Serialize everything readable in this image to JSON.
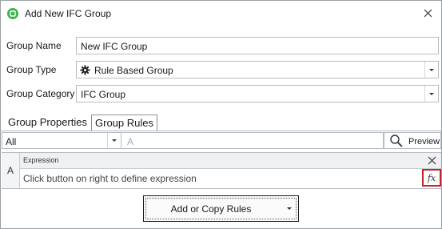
{
  "window": {
    "title": "Add New IFC Group",
    "icon": "app-logo-icon",
    "close_icon": "close-icon"
  },
  "form": {
    "group_name": {
      "label": "Group Name",
      "value": "New IFC Group"
    },
    "group_type": {
      "label": "Group Type",
      "value": "Rule Based Group",
      "icon": "gear-icon"
    },
    "group_category": {
      "label": "Group Category",
      "value": "IFC Group"
    }
  },
  "tabs": [
    {
      "label": "Group Properties",
      "active": false
    },
    {
      "label": "Group Rules",
      "active": true
    }
  ],
  "filter": {
    "select_value": "All",
    "search_placeholder": "A",
    "preview_label": "Preview",
    "preview_icon": "search-icon"
  },
  "rule": {
    "letter": "A",
    "header_label": "Expression",
    "placeholder_text": "Click button on right to define expression",
    "fx_label": "fx",
    "remove_icon": "close-icon"
  },
  "actions": {
    "add_copy_label": "Add or Copy Rules"
  },
  "colors": {
    "accent_green": "#3cb54a",
    "highlight_red": "#c0262d",
    "border": "#b7bcc2"
  }
}
